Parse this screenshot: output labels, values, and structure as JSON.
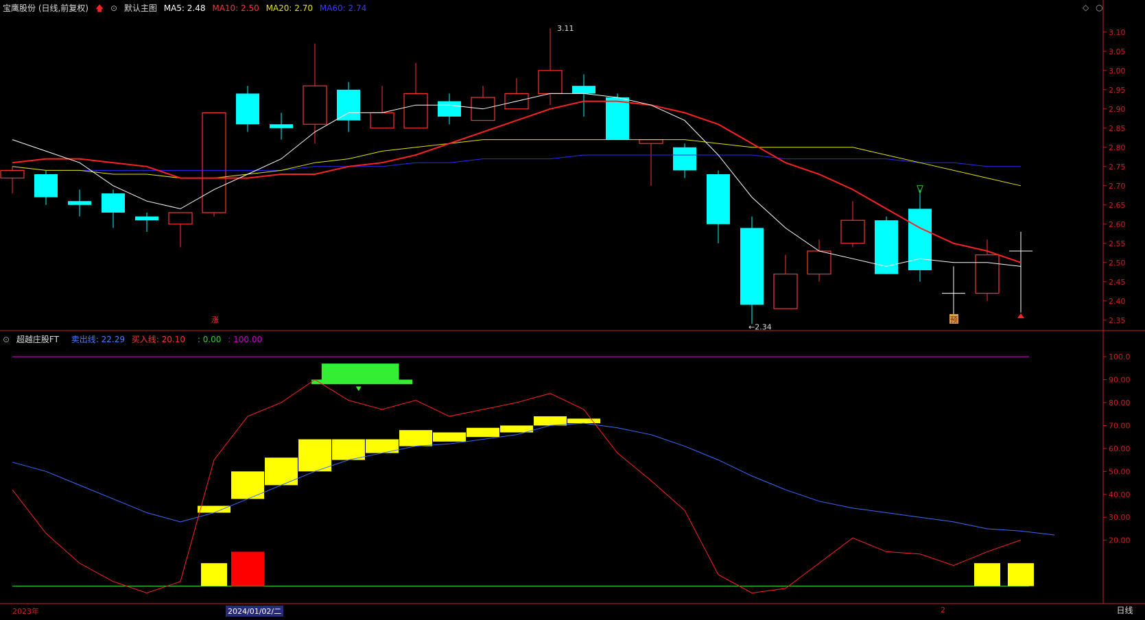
{
  "main_header": {
    "stock_title": "宝鹰股份 (日线,前复权)",
    "chart_template": "默认主图",
    "ma5_label": "MA5: 2.48",
    "ma10_label": "MA10: 2.50",
    "ma20_label": "MA20: 2.70",
    "ma60_label": "MA60: 2.74"
  },
  "sub_header": {
    "indicator_name": "超越庄股FT",
    "sell_line": "卖出线: 22.29",
    "buy_line": "买入线: 20.10",
    "extra1": ": 0.00",
    "extra2": ": 100.00"
  },
  "colors": {
    "up": "#ff3333",
    "down": "#00ffff",
    "ma5": "#ffffff",
    "ma10": "#ff2222",
    "ma20": "#e6e600",
    "ma60": "#2a2aff",
    "sell_line": "#3a6cff",
    "buy_line": "#ff2222",
    "top_line": "#cc00cc",
    "zero_line": "#33cc33",
    "grid_tick": "#cc2222"
  },
  "price_axis_ticks": [
    "3.10",
    "3.05",
    "3.00",
    "2.95",
    "2.90",
    "2.85",
    "2.80",
    "2.75",
    "2.70",
    "2.65",
    "2.60",
    "2.55",
    "2.50",
    "2.45",
    "2.40",
    "2.35"
  ],
  "indicator_axis_ticks": [
    "100.0",
    "90.00",
    "80.00",
    "70.00",
    "60.00",
    "50.00",
    "40.00",
    "30.00",
    "20.00"
  ],
  "annotations": {
    "high_label": "3.11",
    "low_label": "←2.34",
    "marker_zhang": "涨",
    "marker_yu": "预"
  },
  "bottom_bar": {
    "year_label": "2023年",
    "cursor_date": "2024/01/02/二",
    "page_label": "2",
    "period_tab": "日线"
  },
  "chart_data": [
    {
      "type": "candlestick",
      "ylim": [
        2.33,
        3.13
      ],
      "candles": [
        {
          "o": 2.72,
          "c": 2.74,
          "h": 2.75,
          "l": 2.68
        },
        {
          "o": 2.73,
          "c": 2.67,
          "h": 2.74,
          "l": 2.65
        },
        {
          "o": 2.66,
          "c": 2.65,
          "h": 2.69,
          "l": 2.62
        },
        {
          "o": 2.68,
          "c": 2.63,
          "h": 2.69,
          "l": 2.59
        },
        {
          "o": 2.62,
          "c": 2.61,
          "h": 2.63,
          "l": 2.58
        },
        {
          "o": 2.6,
          "c": 2.63,
          "h": 2.63,
          "l": 2.54
        },
        {
          "o": 2.63,
          "c": 2.89,
          "h": 2.89,
          "l": 2.62
        },
        {
          "o": 2.94,
          "c": 2.86,
          "h": 2.96,
          "l": 2.84
        },
        {
          "o": 2.86,
          "c": 2.85,
          "h": 2.89,
          "l": 2.82
        },
        {
          "o": 2.86,
          "c": 2.96,
          "h": 3.07,
          "l": 2.81
        },
        {
          "o": 2.95,
          "c": 2.87,
          "h": 2.97,
          "l": 2.84
        },
        {
          "o": 2.85,
          "c": 2.89,
          "h": 2.96,
          "l": 2.85
        },
        {
          "o": 2.85,
          "c": 2.94,
          "h": 3.02,
          "l": 2.85
        },
        {
          "o": 2.92,
          "c": 2.88,
          "h": 2.94,
          "l": 2.86
        },
        {
          "o": 2.87,
          "c": 2.93,
          "h": 2.96,
          "l": 2.87
        },
        {
          "o": 2.9,
          "c": 2.94,
          "h": 2.98,
          "l": 2.9
        },
        {
          "o": 2.94,
          "c": 3.0,
          "h": 3.11,
          "l": 2.91
        },
        {
          "o": 2.96,
          "c": 2.94,
          "h": 2.99,
          "l": 2.88
        },
        {
          "o": 2.93,
          "c": 2.82,
          "h": 2.94,
          "l": 2.82
        },
        {
          "o": 2.81,
          "c": 2.82,
          "h": 2.82,
          "l": 2.7
        },
        {
          "o": 2.8,
          "c": 2.74,
          "h": 2.81,
          "l": 2.72
        },
        {
          "o": 2.73,
          "c": 2.6,
          "h": 2.74,
          "l": 2.55
        },
        {
          "o": 2.59,
          "c": 2.39,
          "h": 2.62,
          "l": 2.34
        },
        {
          "o": 2.38,
          "c": 2.47,
          "h": 2.52,
          "l": 2.38
        },
        {
          "o": 2.47,
          "c": 2.53,
          "h": 2.56,
          "l": 2.45
        },
        {
          "o": 2.55,
          "c": 2.61,
          "h": 2.66,
          "l": 2.54
        },
        {
          "o": 2.61,
          "c": 2.47,
          "h": 2.62,
          "l": 2.47
        },
        {
          "o": 2.64,
          "c": 2.48,
          "h": 2.69,
          "l": 2.45
        },
        {
          "o": 2.42,
          "c": 2.42,
          "h": 2.49,
          "l": 2.36
        },
        {
          "o": 2.42,
          "c": 2.52,
          "h": 2.56,
          "l": 2.4
        },
        {
          "o": 2.53,
          "c": 2.53,
          "h": 2.58,
          "l": 2.37
        }
      ],
      "ma5": [
        2.82,
        2.79,
        2.76,
        2.7,
        2.66,
        2.64,
        2.69,
        2.73,
        2.77,
        2.84,
        2.89,
        2.89,
        2.91,
        2.91,
        2.9,
        2.92,
        2.94,
        2.94,
        2.93,
        2.91,
        2.87,
        2.78,
        2.67,
        2.59,
        2.53,
        2.51,
        2.49,
        2.51,
        2.5,
        2.5,
        2.49
      ],
      "ma10": [
        2.76,
        2.77,
        2.77,
        2.76,
        2.75,
        2.72,
        2.72,
        2.72,
        2.73,
        2.73,
        2.75,
        2.76,
        2.78,
        2.81,
        2.84,
        2.87,
        2.9,
        2.92,
        2.92,
        2.91,
        2.89,
        2.86,
        2.81,
        2.76,
        2.73,
        2.69,
        2.64,
        2.59,
        2.55,
        2.53,
        2.5
      ],
      "ma20": [
        2.75,
        2.74,
        2.74,
        2.73,
        2.73,
        2.72,
        2.72,
        2.73,
        2.74,
        2.76,
        2.77,
        2.79,
        2.8,
        2.81,
        2.82,
        2.82,
        2.82,
        2.82,
        2.82,
        2.82,
        2.82,
        2.81,
        2.8,
        2.8,
        2.8,
        2.8,
        2.78,
        2.76,
        2.74,
        2.72,
        2.7
      ],
      "ma60": [
        2.75,
        2.74,
        2.74,
        2.74,
        2.74,
        2.74,
        2.74,
        2.74,
        2.74,
        2.75,
        2.75,
        2.75,
        2.76,
        2.76,
        2.77,
        2.77,
        2.77,
        2.78,
        2.78,
        2.78,
        2.78,
        2.78,
        2.78,
        2.77,
        2.77,
        2.77,
        2.77,
        2.76,
        2.76,
        2.75,
        2.75
      ]
    },
    {
      "type": "line",
      "ylim": [
        -7,
        106
      ],
      "sell_line": [
        54,
        50,
        44,
        38,
        32,
        28,
        32,
        38,
        44,
        50,
        55,
        58,
        61,
        62,
        64,
        66,
        70,
        71,
        69,
        66,
        61,
        55,
        48,
        42,
        37,
        34,
        32,
        30,
        28,
        25,
        24,
        22.29
      ],
      "buy_line": [
        42,
        23,
        10,
        2,
        -3,
        2,
        55,
        74,
        80,
        90,
        81,
        77,
        81,
        74,
        77,
        80,
        84,
        77,
        58,
        46,
        33,
        5,
        -3,
        -1,
        10,
        21,
        15,
        14,
        9,
        15,
        20.1
      ],
      "yellow_blocks": [
        {
          "i": 6,
          "bottom": 32,
          "top": 35
        },
        {
          "i": 7,
          "bottom": 38,
          "top": 50
        },
        {
          "i": 8,
          "bottom": 44,
          "top": 56
        },
        {
          "i": 9,
          "bottom": 50,
          "top": 64
        },
        {
          "i": 10,
          "bottom": 55,
          "top": 64
        },
        {
          "i": 11,
          "bottom": 58,
          "top": 64
        },
        {
          "i": 12,
          "bottom": 61,
          "top": 68
        },
        {
          "i": 13,
          "bottom": 63,
          "top": 67
        },
        {
          "i": 14,
          "bottom": 65,
          "top": 69
        },
        {
          "i": 15,
          "bottom": 67,
          "top": 70
        },
        {
          "i": 16,
          "bottom": 70,
          "top": 74
        },
        {
          "i": 17,
          "bottom": 71,
          "top": 73
        }
      ],
      "bottom_yellow_bars": [
        {
          "i": 6,
          "top": 10
        },
        {
          "i": 29,
          "top": 10
        },
        {
          "i": 30,
          "top": 10
        }
      ],
      "bottom_red_bars": [
        {
          "i": 7,
          "top": 15
        }
      ],
      "green_block": {
        "i_start": 9.2,
        "i_end": 11.5,
        "bottom": 90,
        "top": 97
      },
      "green_base": {
        "i_start": 8.9,
        "i_end": 11.9,
        "bottom": 88,
        "top": 90
      }
    }
  ]
}
